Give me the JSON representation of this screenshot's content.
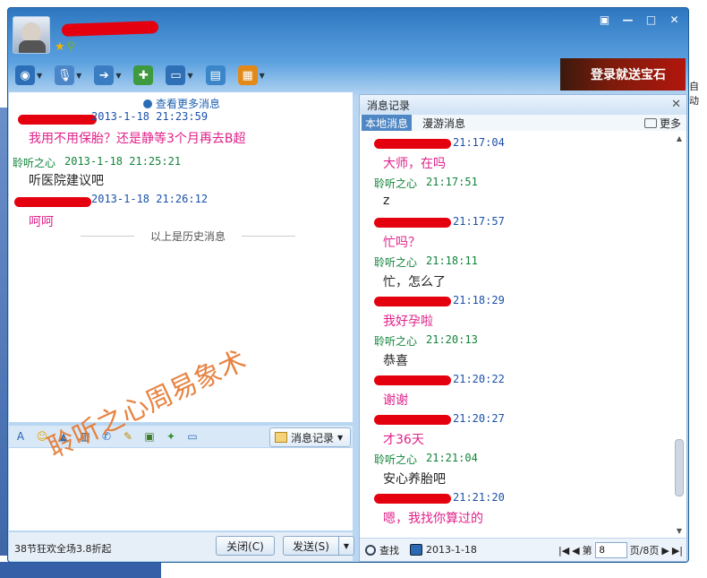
{
  "desktop": {
    "right_label": "自动"
  },
  "window": {
    "controls": [
      "▣",
      "—",
      "□",
      "✕"
    ],
    "status_icons": [
      "★",
      "⚲"
    ]
  },
  "toolbar": {
    "items": [
      {
        "name": "camera-icon",
        "symbol": "◉",
        "color": "#2c6fb8"
      },
      {
        "name": "microphone-icon",
        "symbol": "🎙",
        "color": "#4a86c8"
      },
      {
        "name": "file-transfer-icon",
        "symbol": "➔",
        "color": "#3b7dc2"
      },
      {
        "name": "message-add-icon",
        "symbol": "✚",
        "color": "#3d9a3f"
      },
      {
        "name": "screen-share-icon",
        "symbol": "▭",
        "color": "#2f6fb6"
      },
      {
        "name": "remote-desktop-icon",
        "symbol": "▤",
        "color": "#3a86c9"
      },
      {
        "name": "apps-icon",
        "symbol": "▦",
        "color": "#e2891a"
      }
    ]
  },
  "ad_banner": {
    "text": "登录就送宝石"
  },
  "chat": {
    "view_more": "查看更多消息",
    "messages": [
      {
        "time": "2013-1-18 21:23:59",
        "sender": "",
        "body": "我用不用保胎？还是静等3个月再去B超",
        "style": "pink"
      },
      {
        "time": "2013-1-18 21:25:21",
        "sender": "聆听之心",
        "body": "听医院建议吧",
        "style": "dark"
      },
      {
        "time": "2013-1-18 21:26:12",
        "sender": "",
        "body": "呵呵",
        "style": "pink"
      }
    ],
    "history_separator": "以上是历史消息"
  },
  "format_bar": {
    "icons": [
      {
        "name": "font-icon",
        "symbol": "A"
      },
      {
        "name": "emoji-icon",
        "symbol": "☺"
      },
      {
        "name": "shake-icon",
        "symbol": "▲"
      },
      {
        "name": "film-icon",
        "symbol": "▥"
      },
      {
        "name": "voice-message-icon",
        "symbol": "✆"
      },
      {
        "name": "edit-icon",
        "symbol": "✎"
      },
      {
        "name": "image-icon",
        "symbol": "▣"
      },
      {
        "name": "gift-icon",
        "symbol": "✦"
      },
      {
        "name": "screenshot-icon",
        "symbol": "▭"
      }
    ],
    "history_button": "消息记录"
  },
  "watermark": "聆听之心周易象术",
  "bottom": {
    "ad_text": "38节狂欢全场3.8折起",
    "close": "关闭(C)",
    "send": "发送(S)"
  },
  "history_panel": {
    "title": "消息记录",
    "tab_local": "本地消息",
    "tab_roam": "漫游消息",
    "more": "更多",
    "entries": [
      {
        "time": "21:17:04",
        "sender": "",
        "body": "大师，在吗",
        "style": "pink"
      },
      {
        "time": "21:17:51",
        "sender": "聆听之心",
        "body": "z",
        "style": "dark"
      },
      {
        "time": "21:17:57",
        "sender": "",
        "body": "忙吗？",
        "style": "pink"
      },
      {
        "time": "21:18:11",
        "sender": "聆听之心",
        "body": "忙，怎么了",
        "style": "dark"
      },
      {
        "time": "21:18:29",
        "sender": "",
        "body": "我好孕啦",
        "style": "pink"
      },
      {
        "time": "21:20:13",
        "sender": "聆听之心",
        "body": "恭喜",
        "style": "dark"
      },
      {
        "time": "21:20:22",
        "sender": "",
        "body": "谢谢",
        "style": "pink"
      },
      {
        "time": "21:20:27",
        "sender": "",
        "body": "才36天",
        "style": "pink"
      },
      {
        "time": "21:21:04",
        "sender": "聆听之心",
        "body": "安心养胎吧",
        "style": "dark"
      },
      {
        "time": "21:21:20",
        "sender": "",
        "body": "嗯，我找你算过的",
        "style": "pink"
      }
    ],
    "footer": {
      "search": "查找",
      "date": "2013-1-18",
      "page_prefix": "第",
      "page_current": "8",
      "page_suffix": "页/8页"
    }
  }
}
